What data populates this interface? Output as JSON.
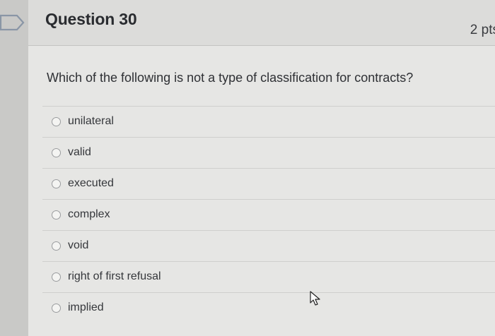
{
  "question": {
    "title": "Question 30",
    "points": "2 pts",
    "text": "Which of the following is not a type of classification for contracts?",
    "answers": [
      {
        "label": "unilateral"
      },
      {
        "label": "valid"
      },
      {
        "label": "executed"
      },
      {
        "label": "complex"
      },
      {
        "label": "void"
      },
      {
        "label": "right of first refusal"
      },
      {
        "label": "implied"
      }
    ]
  },
  "icons": {
    "flag": "flag-outline-icon",
    "cursor": "mouse-pointer-icon"
  },
  "colors": {
    "background": "#d2d2d0",
    "card": "#e6e6e4",
    "text": "#2e3034"
  }
}
